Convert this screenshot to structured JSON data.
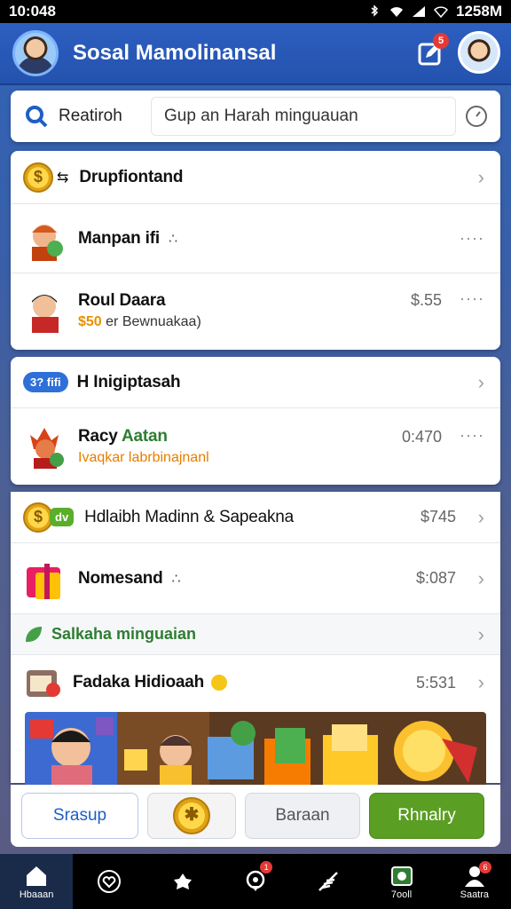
{
  "status_bar": {
    "time": "10:048",
    "clock": "1258M"
  },
  "header": {
    "title": "Sosal Mamolinansal",
    "notif_badge": "5"
  },
  "search": {
    "label": "Reatiroh",
    "placeholder": "Gup an Harah minguauan"
  },
  "sections": [
    {
      "rows": [
        {
          "title": "Drupfiontand",
          "icon": "coin-icon"
        },
        {
          "title": "Manpan ifi",
          "icon": "character-icon",
          "extra": "∴"
        },
        {
          "title": "Roul Daara",
          "sub_amount": "$50",
          "sub_text": "er Bewnuakaa)",
          "amount": "$.55",
          "icon": "character-icon"
        }
      ]
    },
    {
      "rows": [
        {
          "title": "H Inigiptasah",
          "pill": "3? fifi"
        },
        {
          "title_part1": "Racy",
          "title_part2": "Aatan",
          "sub_text": "Ivaqkar labrbinajnanl",
          "amount": "0:470",
          "icon": "character-icon"
        }
      ]
    },
    {
      "rows": [
        {
          "title": "Hdlaibh Madinn & Sapeakna",
          "amount": "$745",
          "pill": "dv"
        },
        {
          "title": "Nomesand",
          "amount": "$:087",
          "extra": "∴"
        }
      ]
    },
    {
      "header": "Salkaha minguaian",
      "rows": [
        {
          "title": "Fadaka Hidioaah",
          "amount": "5:531"
        }
      ]
    }
  ],
  "actions": {
    "sign": "Srasup",
    "back": "Baraan",
    "primary": "Rhnalry"
  },
  "nav": [
    {
      "label": "Hbaaan",
      "icon": "home-icon"
    },
    {
      "label": "",
      "icon": "heart-icon"
    },
    {
      "label": "",
      "icon": "star-icon"
    },
    {
      "label": "",
      "icon": "location-icon",
      "badge": "1"
    },
    {
      "label": "",
      "icon": "feather-icon"
    },
    {
      "label": "7ooll",
      "icon": "message-icon"
    },
    {
      "label": "Saatra",
      "icon": "profile-icon",
      "badge": "6"
    }
  ],
  "colors": {
    "primary": "#2d5fc0",
    "accent_green": "#5a9e23",
    "badge_red": "#e53935"
  }
}
